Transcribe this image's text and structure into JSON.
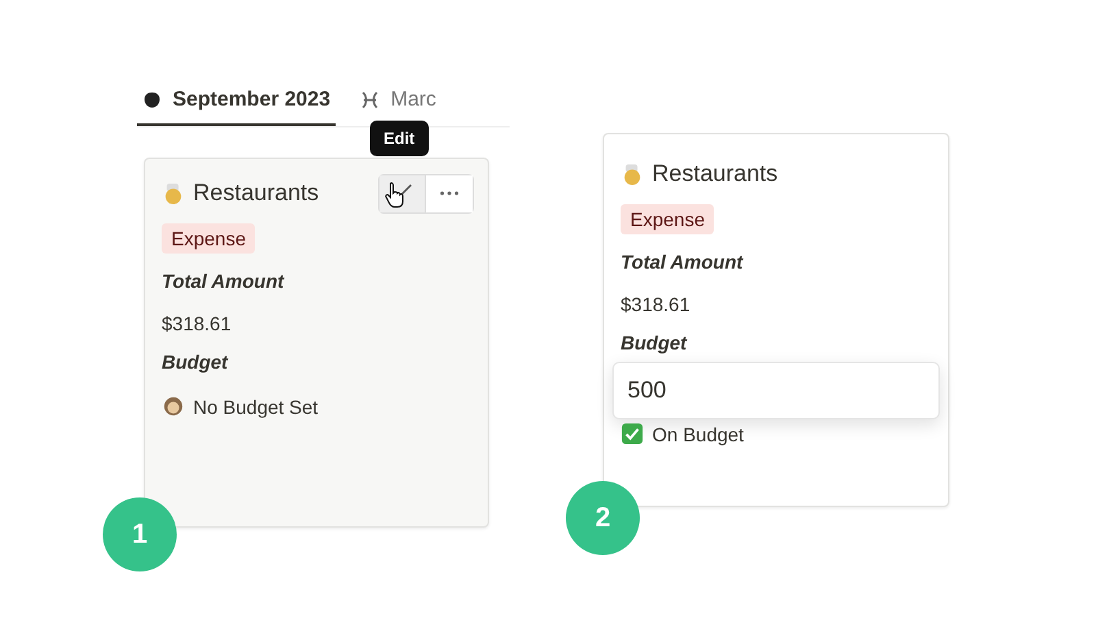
{
  "panels": [
    {
      "step": "1",
      "tabs": [
        {
          "label": "September 2023",
          "kind": "blob",
          "selected": true
        },
        {
          "label": "Marc",
          "kind": "pisces",
          "selected": false
        }
      ],
      "tooltip": "Edit",
      "card": {
        "title": "Restaurants",
        "hovered": true,
        "tag": "Expense",
        "total_label": "Total Amount",
        "total": "$318.61",
        "budget_label": "Budget",
        "budget_status": {
          "kind": "none",
          "text": "No Budget Set"
        }
      }
    },
    {
      "step": "2",
      "card": {
        "title": "Restaurants",
        "hovered": false,
        "tag": "Expense",
        "total_label": "Total Amount",
        "total": "$318.61",
        "budget_label": "Budget",
        "budget_editor": {
          "value": "500"
        },
        "budget_status": {
          "kind": "ok",
          "text": "On Budget"
        }
      }
    }
  ]
}
